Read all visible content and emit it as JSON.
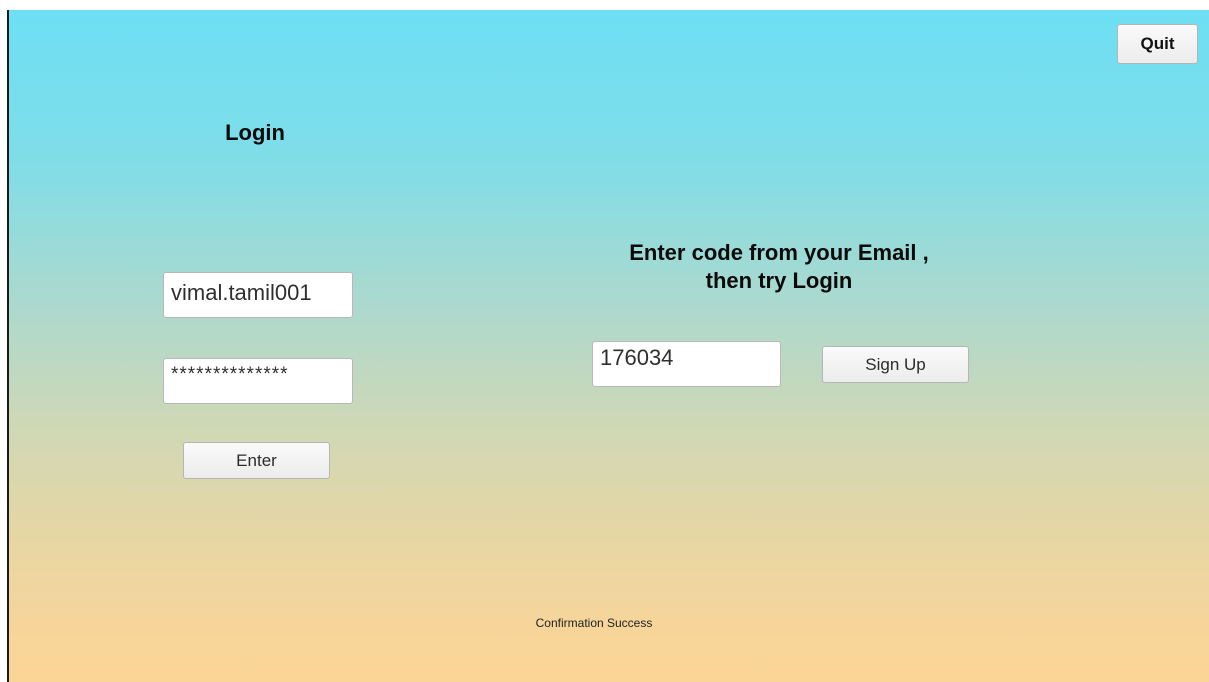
{
  "login": {
    "title": "Login",
    "username_value": "vimal.tamil001",
    "password_value": "**************",
    "enter_label": "Enter"
  },
  "confirmation": {
    "instruction_line1": "Enter code from your Email ,",
    "instruction_line2": "then try Login",
    "code_value": "176034",
    "signup_label": "Sign Up"
  },
  "quit_label": "Quit",
  "status_message": "Confirmation Success"
}
